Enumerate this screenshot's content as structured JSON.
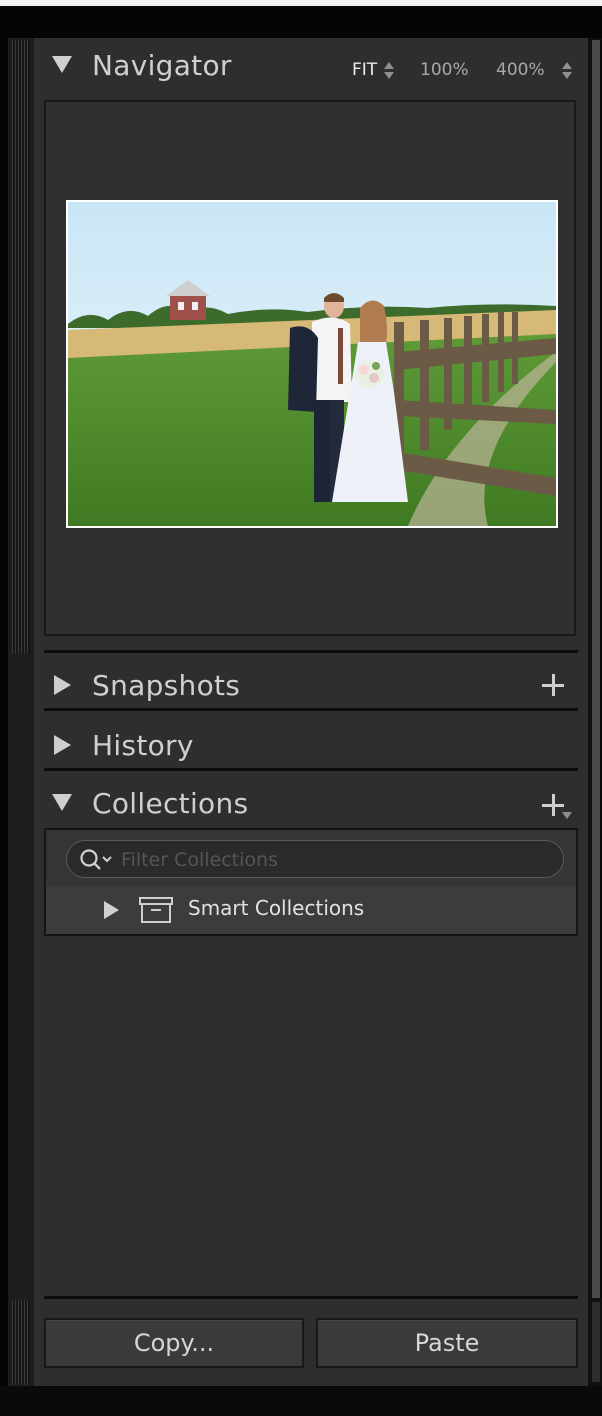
{
  "navigator": {
    "title": "Navigator",
    "zoom_options": [
      "FIT",
      "100%",
      "400%"
    ],
    "active_zoom": "FIT"
  },
  "snapshots": {
    "title": "Snapshots"
  },
  "history": {
    "title": "History"
  },
  "collections": {
    "title": "Collections",
    "filter_placeholder": "Filter Collections",
    "items": [
      {
        "label": "Smart Collections"
      }
    ]
  },
  "buttons": {
    "copy": "Copy...",
    "paste": "Paste"
  },
  "icons": [
    "triangle-down-icon",
    "triangle-right-icon",
    "plus-icon",
    "search-icon",
    "collection-set-icon"
  ]
}
